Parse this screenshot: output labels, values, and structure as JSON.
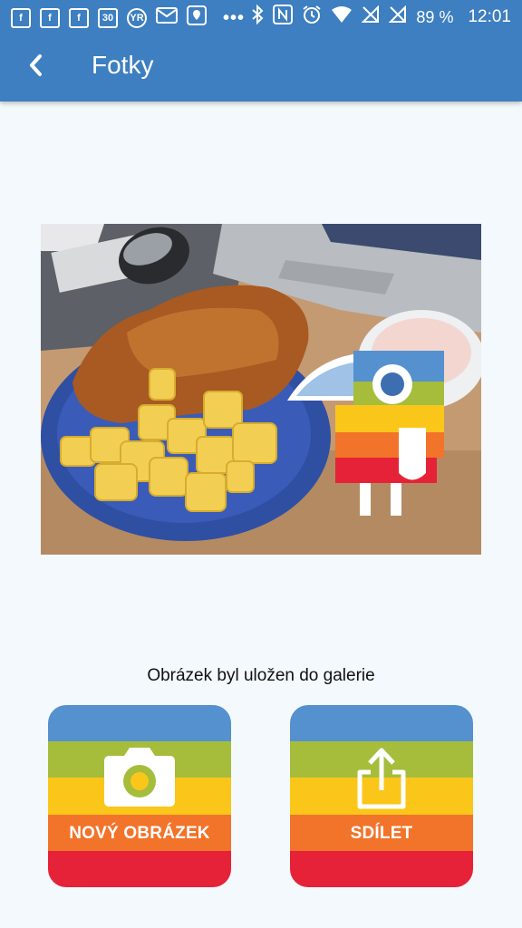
{
  "status_bar": {
    "left_icons": [
      "facebook-icon",
      "facebook-icon",
      "facebook-icon",
      "calendar-icon",
      "yr-icon",
      "gmail-icon",
      "maps-icon"
    ],
    "calendar_day": "30",
    "yr_text": "YR",
    "overflow": "•••",
    "battery": "89 %",
    "time": "12:01"
  },
  "app_bar": {
    "title": "Fotky",
    "back_icon": "back-arrow-icon"
  },
  "main": {
    "saved_message": "Obrázek byl uložen do galerie"
  },
  "buttons": {
    "new_image_label": "NOVÝ OBRÁZEK",
    "new_image_icon": "camera-icon",
    "share_label": "SDÍLET",
    "share_icon": "share-icon"
  },
  "colors": {
    "app_bar": "#3d7fc1",
    "stripes": [
      "#5591cf",
      "#a5bd3b",
      "#fbc61a",
      "#f2732a",
      "#e52237"
    ]
  }
}
